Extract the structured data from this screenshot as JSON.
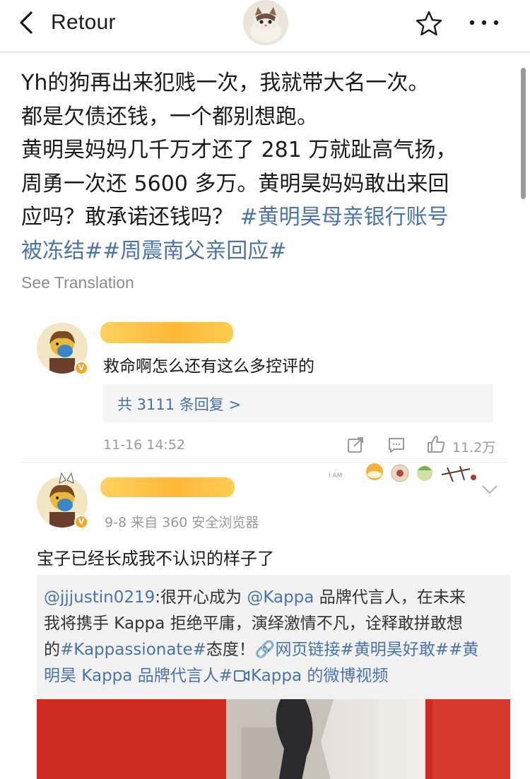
{
  "nav": {
    "back_label": "Retour",
    "icons": [
      "chevron-left-icon",
      "star-icon",
      "more-icon"
    ]
  },
  "post": {
    "lines": [
      "Yh的狗再出来犯贱一次，我就带大名一次。",
      "都是欠债还钱，一个都别想跑。",
      "黄明昊妈妈几千万才还了 281 万就趾高气扬，",
      "周勇一次还 5600 多万。黄明昊妈妈敢出来回"
    ],
    "line5_text": "应吗？敢承诺还钱吗？ ",
    "hashtag_1": "#黄明昊母亲银行账号",
    "hashtag_1_cont": "被冻结#",
    "hashtag_2": "#周震南父亲回应#",
    "see_translation": "See Translation"
  },
  "comments": [
    {
      "text": "救命啊怎么还有这么多控评的",
      "replies": "共 3111 条回复 >",
      "timestamp": "11-16 14:52",
      "likes": "11.2万",
      "verified_badge": "V"
    },
    {
      "meta": "9-8  来自 360 安全浏览器",
      "text": "宝子已经长成我不认识的样子了",
      "verified_badge": "V",
      "sticker_label": "I AM"
    }
  ],
  "repost": {
    "mention_1": "@jjjustin0219",
    "line1_rest": ":很开心成为 ",
    "mention_2": "@Kappa",
    "line1_end": " 品牌代言人，在未来",
    "line2": "我将携手 Kappa 拒绝平庸，演绎激情不凡，诠释敢拼敢想",
    "line3_start": "的",
    "tag_kappassionate": "#Kappassionate#",
    "line3_mid": "态度！",
    "web_link": "🔗网页链接",
    "tag_brave": "#黄明昊好敢#",
    "tag_ambassador_start": "#黄",
    "tag_ambassador_end": "明昊 Kappa 品牌代言人#",
    "video_link": "Kappa 的微博视频"
  },
  "colors": {
    "link": "#4a73a8",
    "muted": "#9a9a9a",
    "badge": "#f5a623",
    "video_red": "#cf2a20"
  }
}
